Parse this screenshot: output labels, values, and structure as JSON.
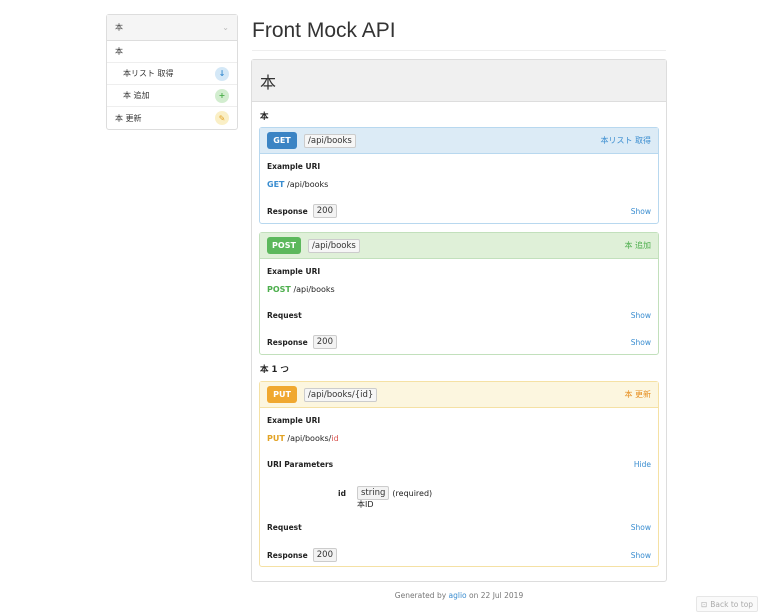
{
  "sidebar": {
    "header": "本",
    "group_label": "本",
    "items": [
      {
        "label": "本リスト 取得",
        "icon": "arrow-down-icon"
      },
      {
        "label": "本 追加",
        "icon": "plus-icon"
      }
    ],
    "extra": {
      "label": "本 更新",
      "icon": "pencil-icon"
    }
  },
  "page_title": "Front Mock API",
  "group": {
    "name": "本"
  },
  "resources": [
    {
      "title": "本"
    },
    {
      "title": "本 1 つ"
    }
  ],
  "actions": {
    "get": {
      "method": "GET",
      "uri": "/api/books",
      "name": "本リスト 取得",
      "example_label": "Example URI",
      "example_method": "GET",
      "example_path": "/api/books",
      "response_label": "Response",
      "response_code": "200",
      "show": "Show"
    },
    "post": {
      "method": "POST",
      "uri": "/api/books",
      "name": "本 追加",
      "example_label": "Example URI",
      "example_method": "POST",
      "example_path": "/api/books",
      "request_label": "Request",
      "request_show": "Show",
      "response_label": "Response",
      "response_code": "200",
      "show": "Show"
    },
    "put": {
      "method": "PUT",
      "uri": "/api/books/{id}",
      "name": "本 更新",
      "example_label": "Example URI",
      "example_method": "PUT",
      "example_path": "/api/books/",
      "example_param": "id",
      "params_label": "URI Parameters",
      "hide": "Hide",
      "param_name": "id",
      "param_type": "string",
      "param_required": "(required)",
      "param_desc": "本ID",
      "request_label": "Request",
      "request_show": "Show",
      "response_label": "Response",
      "response_code": "200",
      "show": "Show"
    }
  },
  "footer": {
    "prefix": "Generated by",
    "tool": "aglio",
    "suffix": "on 22 Jul 2019"
  },
  "back_to_top": "Back to top"
}
